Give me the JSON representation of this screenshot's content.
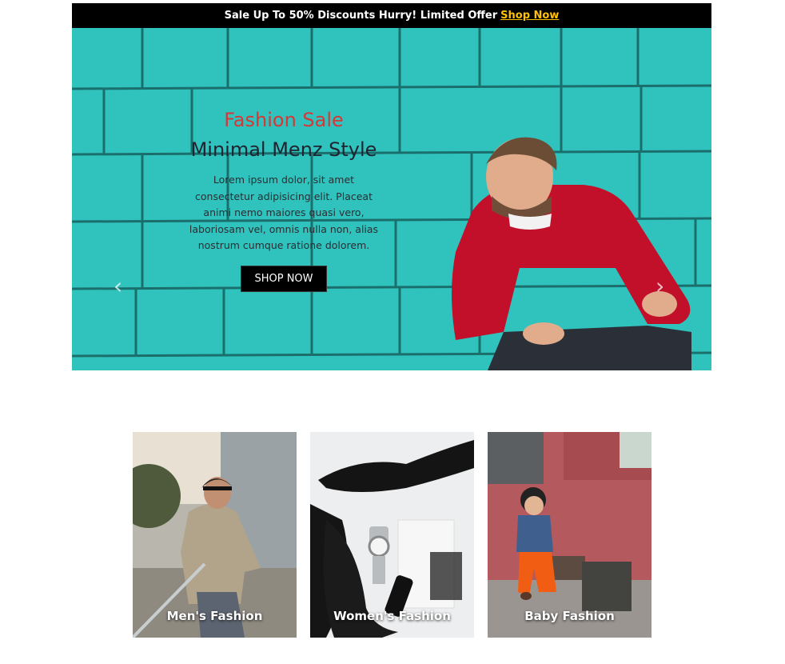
{
  "topbar": {
    "text": "Sale Up To 50% Discounts Hurry! Limited Offer",
    "link": "Shop Now"
  },
  "hero": {
    "pretitle": "Fashion Sale",
    "title": "Minimal Menz Style",
    "description": "Lorem ipsum dolor, sit amet consectetur adipisicing elit. Placeat animi nemo maiores quasi vero, laboriosam vel, omnis nulla non, alias nostrum cumque ratione dolorem.",
    "button": "SHOP NOW",
    "prev_icon": "chevron-left-icon",
    "next_icon": "chevron-right-icon"
  },
  "categories": [
    {
      "label": "Men's Fashion"
    },
    {
      "label": "Women's Fashion"
    },
    {
      "label": "Baby Fashion"
    }
  ],
  "colors": {
    "accent_link": "#ffc107",
    "pretitle": "#d63737",
    "hero_bg": "#2fc4be"
  }
}
